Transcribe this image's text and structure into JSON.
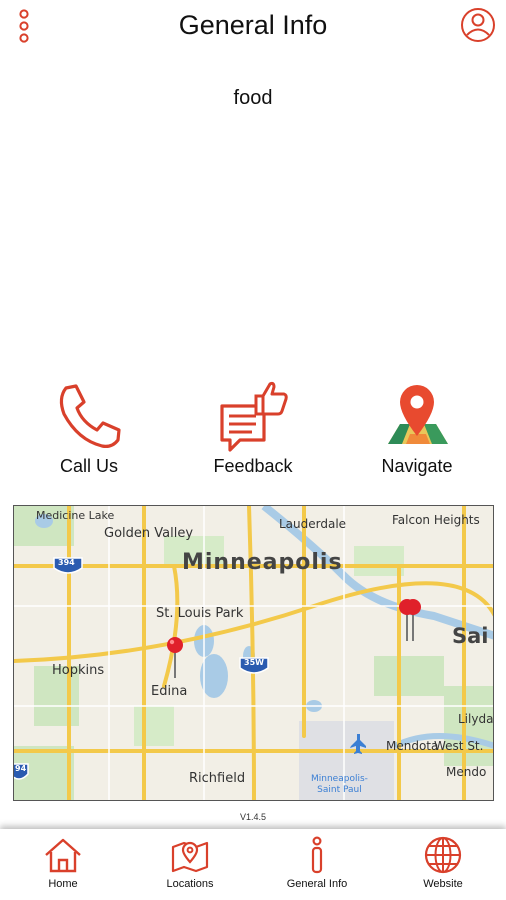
{
  "header": {
    "title": "General Info"
  },
  "content": {
    "text": "food"
  },
  "actions": [
    {
      "label": "Call Us",
      "icon": "phone-icon"
    },
    {
      "label": "Feedback",
      "icon": "feedback-icon"
    },
    {
      "label": "Navigate",
      "icon": "map-pin-icon"
    }
  ],
  "map": {
    "labels": {
      "medicine_lake": "Medicine Lake",
      "golden_valley": "Golden Valley",
      "lauderdale": "Lauderdale",
      "falcon_heights": "Falcon Heights",
      "minneapolis": "Minneapolis",
      "st_louis_park": "St. Louis Park",
      "saint_paul_partial": "Sai",
      "hopkins": "Hopkins",
      "edina": "Edina",
      "lilydale": "Lilydal",
      "mendota": "Mendota",
      "west_st": "West St.",
      "mendota_heights_partial": "Mendo",
      "richfield": "Richfield",
      "airport": "Minneapolis-\nSaint Paul"
    },
    "shields": {
      "i394": "394",
      "i35w": "35W",
      "i94": "94"
    }
  },
  "footer": {
    "version": "V1.4.5"
  },
  "tabs": [
    {
      "label": "Home",
      "icon": "home-icon"
    },
    {
      "label": "Locations",
      "icon": "locations-icon"
    },
    {
      "label": "General Info",
      "icon": "info-icon"
    },
    {
      "label": "Website",
      "icon": "globe-icon"
    }
  ],
  "colors": {
    "accent": "#d9402b",
    "text": "#111111"
  }
}
